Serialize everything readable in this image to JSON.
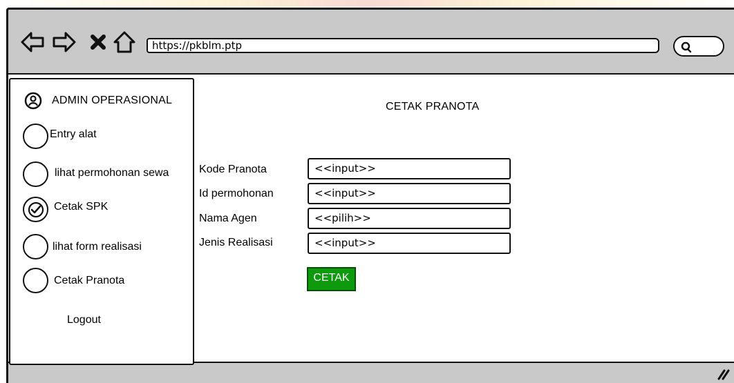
{
  "browser": {
    "url": "https://pkblm.ptp"
  },
  "sidebar": {
    "header_label": "ADMIN OPERASIONAL",
    "items": [
      {
        "label": "Entry alat",
        "checked": false
      },
      {
        "label": "lihat permohonan sewa",
        "checked": false
      },
      {
        "label": "Cetak SPK",
        "checked": true
      },
      {
        "label": "lihat form realisasi",
        "checked": false
      },
      {
        "label": "Cetak Pranota",
        "checked": false
      }
    ],
    "logout_label": "Logout"
  },
  "main": {
    "title": "CETAK PRANOTA",
    "fields": [
      {
        "label": "Kode Pranota",
        "value": "<<input>>"
      },
      {
        "label": "Id permohonan",
        "value": "<<input>>"
      },
      {
        "label": "Nama Agen",
        "value": "<<pilih>>"
      },
      {
        "label": "Jenis Realisasi",
        "value": "<<input>>"
      }
    ],
    "print_button_label": "CETAK"
  },
  "colors": {
    "frame": "#c9c9c9",
    "button": "#0d9a0d"
  },
  "icons": [
    "back-arrow-icon",
    "forward-arrow-icon",
    "close-x-icon",
    "home-icon",
    "search-icon",
    "user-icon",
    "check-icon",
    "resize-grip-icon"
  ]
}
